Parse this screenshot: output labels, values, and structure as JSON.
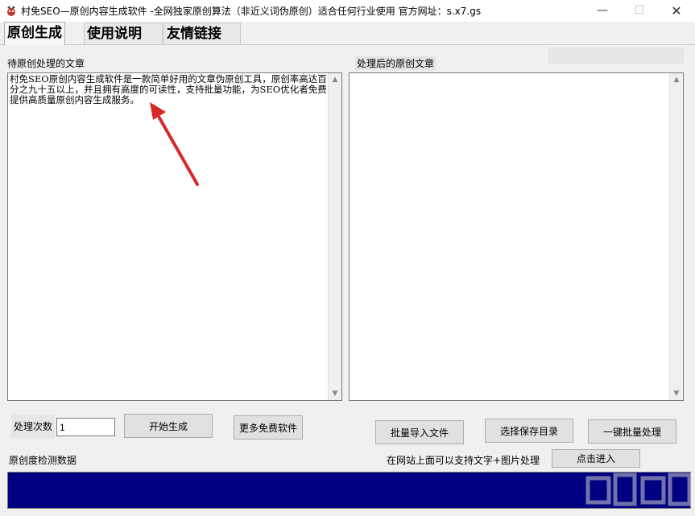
{
  "window": {
    "title": "村免SEO—原创内容生成软件 -全网独家原创算法（非近义词伪原创）适合任何行业使用 官方网址：s.x7.gs",
    "minimize_glyph": "—",
    "maximize_glyph": "☐",
    "close_glyph": "✕"
  },
  "tabs": [
    {
      "label": "原创生成"
    },
    {
      "label": "使用说明"
    },
    {
      "label": "友情链接"
    }
  ],
  "input_panel": {
    "label": "待原创处理的文章",
    "text": "村免SEO原创内容生成软件是一款简单好用的文章伪原创工具，原创率高达百分之九十五以上，并且拥有高度的可读性，支持批量功能，为SEO优化者免费提供高质量原创内容生成服务。"
  },
  "output_panel": {
    "label": "处理后的原创文章"
  },
  "controls": {
    "count_label": "处理次数",
    "count_value": "1",
    "start_button": "开始生成",
    "more_button": "更多免费软件",
    "import_button": "批量导入文件",
    "save_dir_button": "选择保存目录",
    "batch_button": "一键批量处理",
    "detect_label": "原创度检测数据",
    "support_label": "在网站上面可以支持文字+图片处理",
    "enter_button": "点击进入"
  },
  "colors": {
    "progress_fill": "#000080",
    "arrow": "#d42a2a"
  },
  "icons": {
    "app": "app-icon",
    "scroll_up": "▲",
    "scroll_down": "▼"
  }
}
